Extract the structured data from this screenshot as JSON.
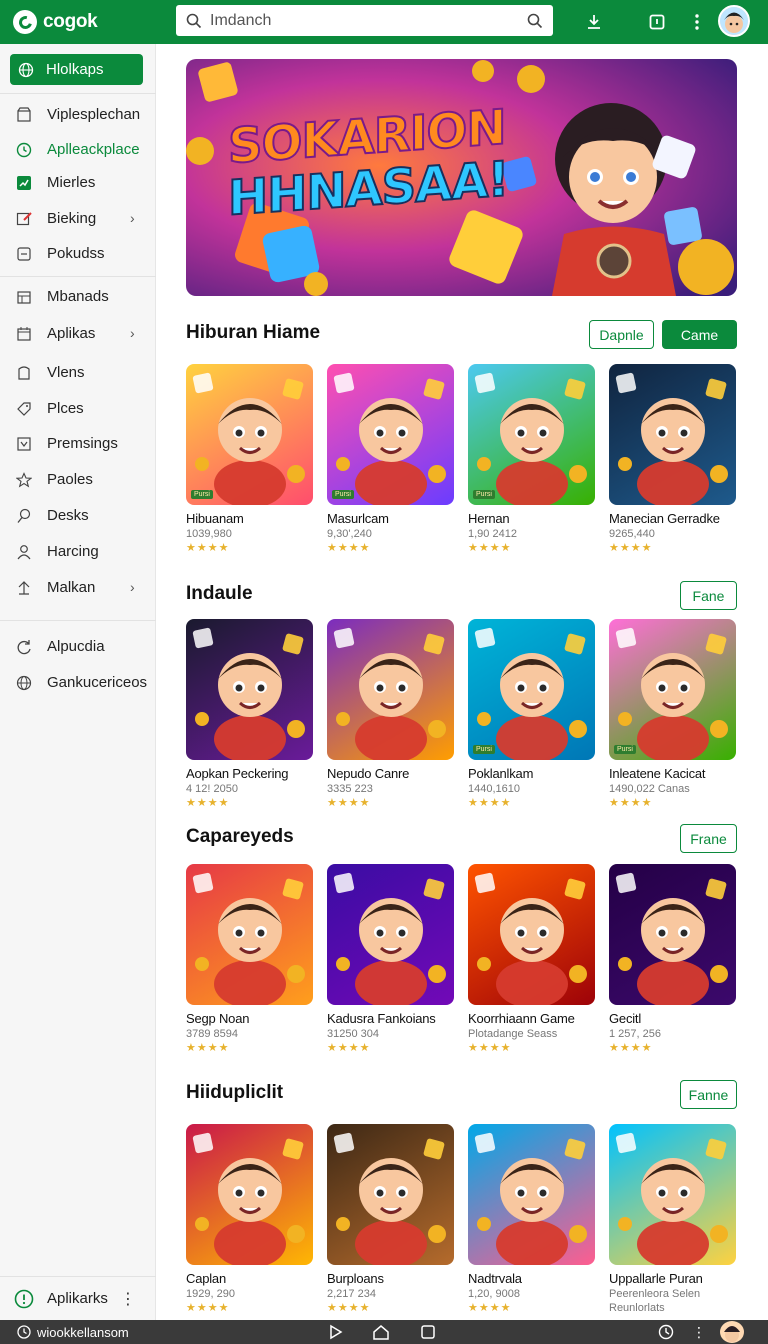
{
  "app": {
    "logo_text": "cogok"
  },
  "search": {
    "value": "Imdanch"
  },
  "sidebar": {
    "active_label": "Hlolkaps",
    "items": [
      {
        "label": "Viplesplechan",
        "icon": "store-icon",
        "chevron": false
      },
      {
        "label": "Aplleackplace",
        "icon": "clock-icon",
        "chevron": false,
        "highlight": true
      },
      {
        "label": "Mierles",
        "icon": "chart-icon",
        "chevron": false
      },
      {
        "label": "Bieking",
        "icon": "edit-icon",
        "chevron": true
      },
      {
        "label": "Pokudss",
        "icon": "square-icon",
        "chevron": false
      },
      {
        "label": "Mbanads",
        "icon": "grid-icon",
        "chevron": false
      },
      {
        "label": "Aplikas",
        "icon": "calendar-icon",
        "chevron": true
      },
      {
        "label": "Vlens",
        "icon": "user-icon",
        "chevron": false
      },
      {
        "label": "Plces",
        "icon": "tag-icon",
        "chevron": false
      },
      {
        "label": "Premsings",
        "icon": "box-icon",
        "chevron": false
      },
      {
        "label": "Paoles",
        "icon": "star-icon",
        "chevron": false
      },
      {
        "label": "Desks",
        "icon": "pin-icon",
        "chevron": false
      },
      {
        "label": "Harcing",
        "icon": "person-icon",
        "chevron": false
      },
      {
        "label": "Malkan",
        "icon": "upload-icon",
        "chevron": true
      },
      {
        "label": "Alpucdia",
        "icon": "refresh-icon",
        "chevron": false
      },
      {
        "label": "Gankucericeos",
        "icon": "globe-icon",
        "chevron": false
      }
    ],
    "bottom_label": "Aplikarks"
  },
  "banner": {
    "line1": "SOKARION",
    "line2": "HHNASAA!"
  },
  "sections": [
    {
      "title": "Hiburan Hiame",
      "buttons": [
        "Dapnle",
        "Came"
      ],
      "cards": [
        {
          "name": "Hibuanam",
          "meta": "1039,980",
          "stars": "★★★★",
          "badge": "Pursi"
        },
        {
          "name": "Masurlcam",
          "meta": "9,30',240",
          "stars": "★★★★",
          "badge": "Pursi"
        },
        {
          "name": "Hernan",
          "meta": "1,90 2412",
          "stars": "★★★★",
          "badge": "Pursi"
        },
        {
          "name": "Manecian Gerradke",
          "meta": "9265,440",
          "stars": "★★★★",
          "badge": ""
        }
      ]
    },
    {
      "title": "Indaule",
      "buttons": [
        "Fane"
      ],
      "cards": [
        {
          "name": "Aopkan Peckering",
          "meta": "4 12! 2050",
          "stars": "★★★★",
          "badge": ""
        },
        {
          "name": "Nepudo Canre",
          "meta": "3335 223",
          "stars": "★★★★",
          "badge": ""
        },
        {
          "name": "Poklanlkam",
          "meta": "1440,1610",
          "stars": "★★★★",
          "badge": "Pursi"
        },
        {
          "name": "Inleatene Kacicat",
          "meta": "1490,022 Canas",
          "stars": "★★★★",
          "badge": "Pursi"
        }
      ]
    },
    {
      "title": "Capareyeds",
      "buttons": [
        "Frane"
      ],
      "cards": [
        {
          "name": "Segp Noan",
          "meta": "3789 8594",
          "stars": "★★★★",
          "badge": ""
        },
        {
          "name": "Kadusra Fankoians",
          "meta": "31250 304",
          "stars": "★★★★",
          "badge": ""
        },
        {
          "name": "Koorrhiaann Game",
          "meta": "Plotadange Seass",
          "stars": "★★★★",
          "badge": ""
        },
        {
          "name": "Gecitl",
          "meta": "1 257, 256",
          "stars": "★★★★",
          "badge": ""
        }
      ]
    },
    {
      "title": "Hiidupliclit",
      "buttons": [
        "Fanne"
      ],
      "cards": [
        {
          "name": "Caplan",
          "meta": "1929, 290",
          "stars": "★★★★",
          "badge": ""
        },
        {
          "name": "Burploans",
          "meta": "2,217 234",
          "stars": "★★★★",
          "badge": ""
        },
        {
          "name": "Nadtrvala",
          "meta": "1,20, 9008",
          "stars": "★★★★",
          "badge": ""
        },
        {
          "name": "Uppallarle Puran",
          "meta": "Peerenleora Selen",
          "meta2": "Reunlorlats",
          "stars": "",
          "badge": ""
        }
      ]
    }
  ],
  "thumb_icons": [
    "cowboy-boy-icon",
    "blue-bear-icon",
    "wolf-warrior-icon",
    "golden-bear-icon",
    "glowing-dice-icon",
    "girl-character-icon",
    "golden-cat-icon",
    "pink-bear-icon",
    "boy-watermelon-icon",
    "girl-dumplings-icon",
    "boy-rice-icon",
    "dance-crew-icon",
    "red-hat-boy-icon",
    "yellow-shirt-boy-icon",
    "red-shirt-girl-icon",
    "pink-bear-sky-icon"
  ],
  "bottombar": {
    "url": "wiookkellansom"
  },
  "colors": {
    "brand": "#0b8a3c",
    "sidebar_bg": "#f6f6f6",
    "star": "#e7b22d"
  }
}
